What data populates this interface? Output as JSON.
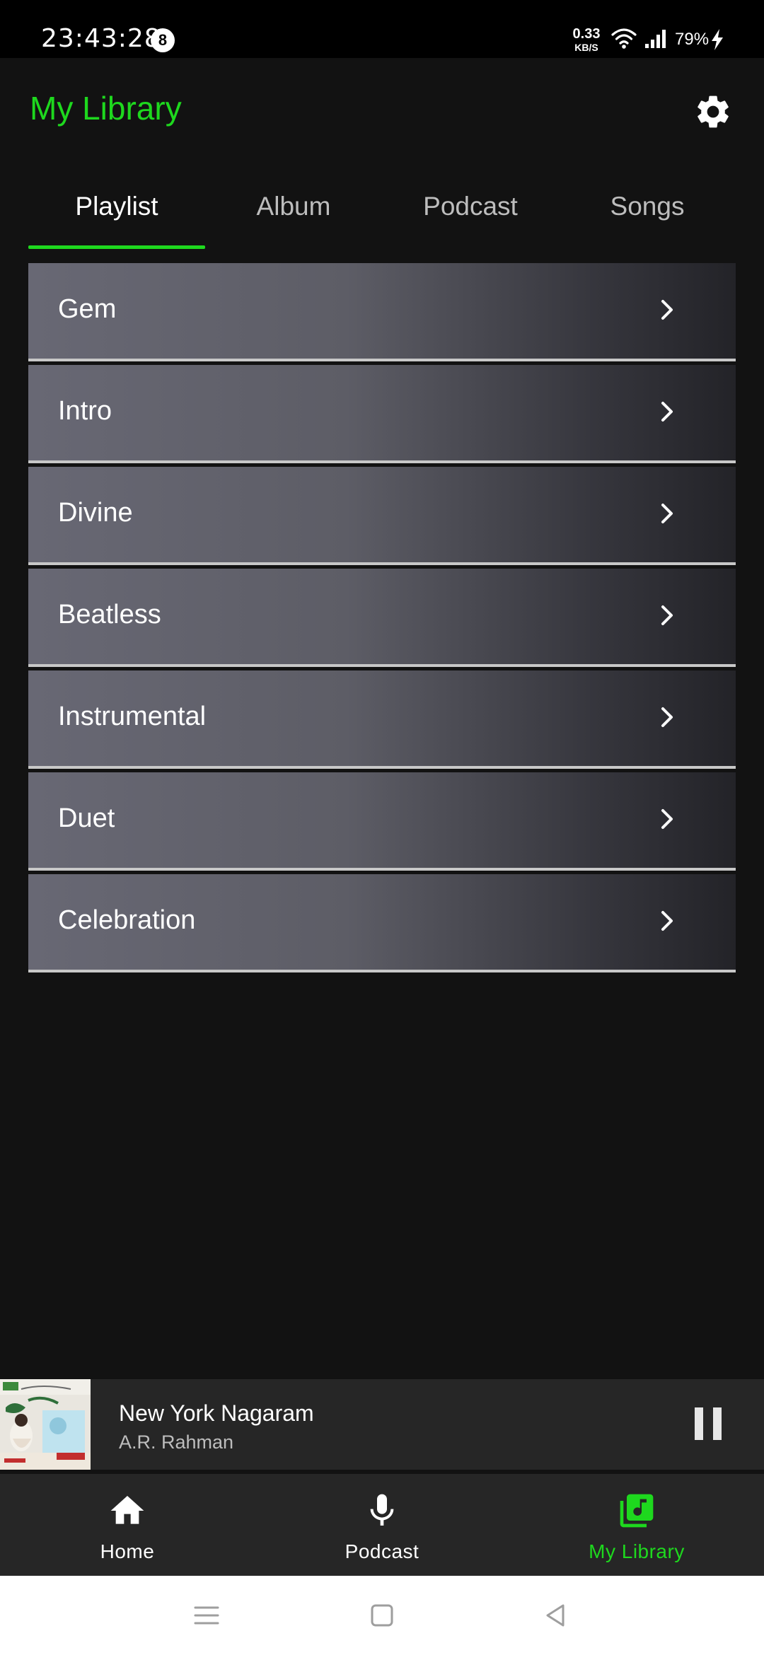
{
  "status_bar": {
    "time": "23:43:28",
    "notification_count": "8",
    "net_speed_value": "0.33",
    "net_speed_unit": "KB/S",
    "battery": "79%"
  },
  "header": {
    "title": "My Library",
    "settings_icon": "gear-icon"
  },
  "tabs": [
    {
      "label": "Playlist",
      "active": true
    },
    {
      "label": "Album",
      "active": false
    },
    {
      "label": "Podcast",
      "active": false
    },
    {
      "label": "Songs",
      "active": false
    }
  ],
  "playlists": [
    {
      "name": "Gem"
    },
    {
      "name": "Intro"
    },
    {
      "name": "Divine"
    },
    {
      "name": "Beatless"
    },
    {
      "name": "Instrumental"
    },
    {
      "name": "Duet"
    },
    {
      "name": "Celebration"
    }
  ],
  "now_playing": {
    "title": "New York Nagaram",
    "artist": "A.R. Rahman",
    "state_icon": "pause-icon"
  },
  "bottom_nav": [
    {
      "label": "Home",
      "icon": "home-icon",
      "active": false
    },
    {
      "label": "Podcast",
      "icon": "microphone-icon",
      "active": false
    },
    {
      "label": "My Library",
      "icon": "library-music-icon",
      "active": true
    }
  ],
  "colors": {
    "accent": "#1ed81e",
    "background": "#121212",
    "bar": "#262626"
  }
}
